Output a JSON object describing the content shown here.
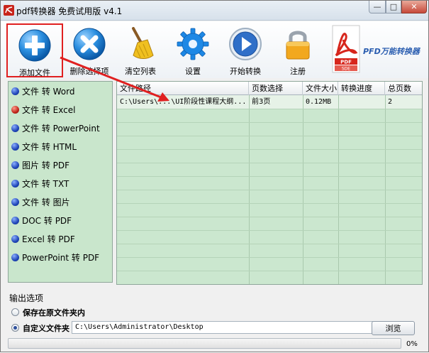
{
  "window": {
    "title": "pdf转换器 免费试用版 v4.1",
    "min_glyph": "—",
    "max_glyph": "□",
    "close_glyph": "✕"
  },
  "toolbar": {
    "add_label": "添加文件",
    "delete_label": "删除选择项",
    "clear_label": "清空列表",
    "settings_label": "设置",
    "start_label": "开始转换",
    "register_label": "注册",
    "brand_text": "PFD万能转换器",
    "brand_doc_label_1": "PDF",
    "brand_doc_label_2": "SDE"
  },
  "left_menu": [
    {
      "label": "文件 转 Word"
    },
    {
      "label": "文件 转 Excel"
    },
    {
      "label": "文件 转 PowerPoint"
    },
    {
      "label": "文件 转 HTML"
    },
    {
      "label": "图片 转 PDF"
    },
    {
      "label": "文件 转 TXT"
    },
    {
      "label": "文件 转 图片"
    },
    {
      "label": "DOC 转 PDF"
    },
    {
      "label": "Excel 转 PDF"
    },
    {
      "label": "PowerPoint 转 PDF"
    }
  ],
  "table": {
    "headers": [
      "文件路径",
      "页数选择",
      "文件大小",
      "转换进度",
      "总页数"
    ],
    "rows": [
      {
        "path": "C:\\Users\\...\\UI阶段性课程大纲...",
        "pages": "前3页",
        "size": "0.12MB",
        "progress": "",
        "total": "2"
      }
    ]
  },
  "output": {
    "title": "输出选项",
    "option_same_folder": "保存在原文件夹内",
    "option_custom_folder": "自定义文件夹",
    "path_value": "C:\\Users\\Administrator\\Desktop",
    "browse_label": "浏览",
    "progress_percent": 0,
    "progress_text": "0%"
  },
  "colors": {
    "highlight_border": "#e02020",
    "arrow": "#e02020",
    "list_bg": "#c9e6cc"
  }
}
